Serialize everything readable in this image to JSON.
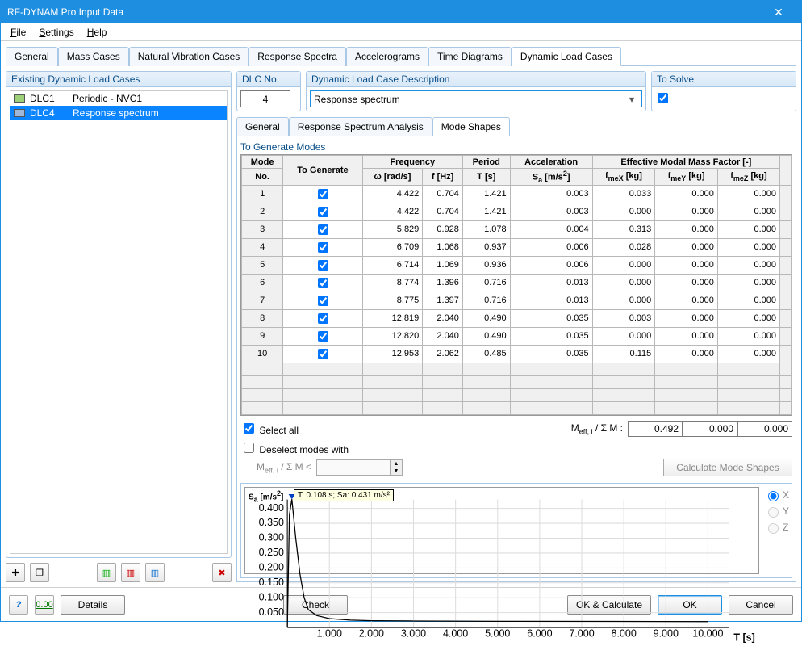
{
  "window": {
    "title": "RF-DYNAM Pro Input Data"
  },
  "menu": {
    "file": "File",
    "settings": "Settings",
    "help": "Help"
  },
  "main_tabs": [
    "General",
    "Mass Cases",
    "Natural Vibration Cases",
    "Response Spectra",
    "Accelerograms",
    "Time Diagrams",
    "Dynamic Load Cases"
  ],
  "left": {
    "title": "Existing Dynamic Load Cases",
    "items": [
      {
        "code": "DLC1",
        "desc": "Periodic - NVC1",
        "color": "#9ed07a",
        "selected": false
      },
      {
        "code": "DLC4",
        "desc": "Response spectrum",
        "color": "#9fb8d9",
        "selected": true
      }
    ]
  },
  "dlc_no": {
    "label": "DLC No.",
    "value": "4"
  },
  "dlc_desc": {
    "label": "Dynamic Load Case Description",
    "value": "Response spectrum"
  },
  "to_solve": {
    "label": "To Solve",
    "checked": true
  },
  "sub_tabs": [
    "General",
    "Response Spectrum Analysis",
    "Mode Shapes"
  ],
  "modes": {
    "title": "To Generate Modes",
    "headers": {
      "mode": "Mode",
      "no": "No.",
      "togen": "To Generate",
      "freq": "Frequency",
      "omega": "ω [rad/s]",
      "fhz": "f [Hz]",
      "period": "Period",
      "ts": "T [s]",
      "accel": "Acceleration",
      "sa": "Sₐ [m/s²]",
      "emmf": "Effective Modal Mass Factor [-]",
      "fmex": "f meX [kg]",
      "fmey": "f meY [kg]",
      "fmez": "f meZ [kg]"
    },
    "rows": [
      {
        "no": 1,
        "gen": true,
        "omega": "4.422",
        "fhz": "0.704",
        "ts": "1.421",
        "sa": "0.003",
        "fmex": "0.033",
        "fmey": "0.000",
        "fmez": "0.000"
      },
      {
        "no": 2,
        "gen": true,
        "omega": "4.422",
        "fhz": "0.704",
        "ts": "1.421",
        "sa": "0.003",
        "fmex": "0.000",
        "fmey": "0.000",
        "fmez": "0.000"
      },
      {
        "no": 3,
        "gen": true,
        "omega": "5.829",
        "fhz": "0.928",
        "ts": "1.078",
        "sa": "0.004",
        "fmex": "0.313",
        "fmey": "0.000",
        "fmez": "0.000"
      },
      {
        "no": 4,
        "gen": true,
        "omega": "6.709",
        "fhz": "1.068",
        "ts": "0.937",
        "sa": "0.006",
        "fmex": "0.028",
        "fmey": "0.000",
        "fmez": "0.000"
      },
      {
        "no": 5,
        "gen": true,
        "omega": "6.714",
        "fhz": "1.069",
        "ts": "0.936",
        "sa": "0.006",
        "fmex": "0.000",
        "fmey": "0.000",
        "fmez": "0.000"
      },
      {
        "no": 6,
        "gen": true,
        "omega": "8.774",
        "fhz": "1.396",
        "ts": "0.716",
        "sa": "0.013",
        "fmex": "0.000",
        "fmey": "0.000",
        "fmez": "0.000"
      },
      {
        "no": 7,
        "gen": true,
        "omega": "8.775",
        "fhz": "1.397",
        "ts": "0.716",
        "sa": "0.013",
        "fmex": "0.000",
        "fmey": "0.000",
        "fmez": "0.000"
      },
      {
        "no": 8,
        "gen": true,
        "omega": "12.819",
        "fhz": "2.040",
        "ts": "0.490",
        "sa": "0.035",
        "fmex": "0.003",
        "fmey": "0.000",
        "fmez": "0.000"
      },
      {
        "no": 9,
        "gen": true,
        "omega": "12.820",
        "fhz": "2.040",
        "ts": "0.490",
        "sa": "0.035",
        "fmex": "0.000",
        "fmey": "0.000",
        "fmez": "0.000"
      },
      {
        "no": 10,
        "gen": true,
        "omega": "12.953",
        "fhz": "2.062",
        "ts": "0.485",
        "sa": "0.035",
        "fmex": "0.115",
        "fmey": "0.000",
        "fmez": "0.000"
      }
    ]
  },
  "select_all": {
    "label": "Select all",
    "checked": true
  },
  "meff_sum": {
    "label": "Meff, i / Σ M :",
    "x": "0.492",
    "y": "0.000",
    "z": "0.000"
  },
  "deselect": {
    "label": "Deselect modes with",
    "checked": false,
    "sub": "Meff, i / Σ M <"
  },
  "calc_modes_btn": "Calculate Mode Shapes",
  "chart": {
    "ylabel": "Sa [m/s²]",
    "xlabel": "T [s]",
    "tooltip": "T: 0.108 s; Sa: 0.431 m/s²",
    "radios": {
      "x": "X",
      "y": "Y",
      "z": "Z"
    }
  },
  "footer": {
    "details": "Details",
    "check": "Check",
    "okcalc": "OK & Calculate",
    "ok": "OK",
    "cancel": "Cancel"
  },
  "chart_data": {
    "type": "line",
    "title": "Response spectrum",
    "xlabel": "T [s]",
    "ylabel": "Sa [m/s²]",
    "xlim": [
      0,
      10.5
    ],
    "ylim": [
      0,
      0.43
    ],
    "xticks": [
      1.0,
      2.0,
      3.0,
      4.0,
      5.0,
      6.0,
      7.0,
      8.0,
      9.0,
      10.0
    ],
    "yticks": [
      0.05,
      0.1,
      0.15,
      0.2,
      0.25,
      0.3,
      0.35,
      0.4
    ],
    "series": [
      {
        "name": "Sa",
        "x": [
          0.0,
          0.05,
          0.108,
          0.2,
          0.3,
          0.4,
          0.5,
          0.7,
          1.0,
          1.5,
          2.0,
          3.0,
          5.0,
          10.0
        ],
        "y": [
          0.0,
          0.38,
          0.431,
          0.3,
          0.18,
          0.1,
          0.06,
          0.04,
          0.03,
          0.025,
          0.023,
          0.022,
          0.021,
          0.02
        ]
      }
    ],
    "annotation": "T: 0.108 s; Sa: 0.431 m/s²"
  }
}
